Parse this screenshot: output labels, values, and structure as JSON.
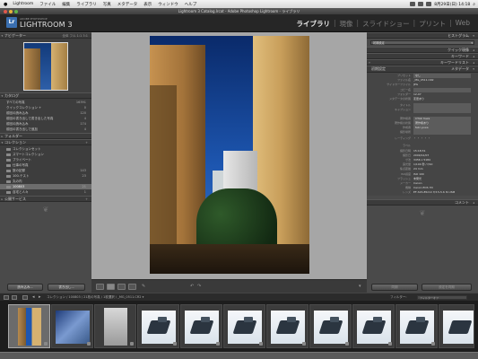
{
  "menubar": {
    "apple": "",
    "items": [
      "Lightroom",
      "ファイル",
      "編集",
      "ライブラリ",
      "写真",
      "メタデータ",
      "表示",
      "ウィンドウ",
      "ヘルプ"
    ],
    "clock": "8月29日(日) 14:18"
  },
  "window": {
    "title": "Lightroom 3 Catalog.lrcat - Adobe Photoshop Lightroom - ライブラリ"
  },
  "identity": {
    "logo": "Lr",
    "brand_small": "ADOBE PHOTOSHOP",
    "brand": "LIGHTROOM 3"
  },
  "modules": [
    {
      "label": "ライブラリ",
      "active": true
    },
    {
      "label": "現像",
      "active": false
    },
    {
      "label": "スライドショー",
      "active": false
    },
    {
      "label": "プリント",
      "active": false
    },
    {
      "label": "Web",
      "active": false
    }
  ],
  "left_panel": {
    "navigator": {
      "title": "ナビゲーター",
      "modes": "全体  フル  1:1  3:1"
    },
    "catalog": {
      "title": "カタログ",
      "items": [
        {
          "label": "すべての写真",
          "count": "16391"
        },
        {
          "label": "クイックコレクション +",
          "count": "0"
        },
        {
          "label": "前回の読み込み",
          "count": "120"
        },
        {
          "label": "前回の書き出しで書き出した写真",
          "count": "4"
        },
        {
          "label": "前回の読み込み",
          "count": "174"
        },
        {
          "label": "前回の書き出しで追加",
          "count": "4"
        }
      ]
    },
    "folders": {
      "title": "フォルダー"
    },
    "collections": {
      "title": "コレクション",
      "items": [
        {
          "label": "コレクションセット",
          "count": ""
        },
        {
          "label": "スマートコレクション",
          "count": ""
        },
        {
          "label": "プライベート",
          "count": ""
        },
        {
          "label": "仕事の写真",
          "count": ""
        },
        {
          "label": "旅の記録",
          "count": "143"
        },
        {
          "label": "100-テスト",
          "count": "23"
        },
        {
          "label": "丸の内",
          "count": ""
        },
        {
          "label": "100803",
          "count": "21",
          "selected": true
        },
        {
          "label": "自宅と人々",
          "count": "1"
        }
      ]
    },
    "publish": {
      "title": "公開サービス"
    },
    "import_button": "読み込み...",
    "export_button": "書き出し..."
  },
  "right_panel": {
    "histogram": {
      "title": "ヒストグラム"
    },
    "quick_develop": {
      "label": "クイック現像"
    },
    "preset_select": "初期設定",
    "keywords": {
      "title": "キーワード"
    },
    "keyword_list": {
      "title": "キーワードリスト"
    },
    "metadata": {
      "title": "メタデータ",
      "preset_label": "初期設定"
    },
    "fields": [
      {
        "k": "プリセット",
        "v": "なし"
      },
      {
        "k": "ファイル名",
        "v": "_MG_0511.CR2"
      },
      {
        "k": "サイドカーファイル",
        "v": "JPG"
      },
      {
        "k": "コピー名",
        "v": ""
      },
      {
        "k": "フォルダー",
        "v": "12-07"
      },
      {
        "k": "メタデータの状態",
        "v": "変更あり"
      },
      {
        "k": "タイトル",
        "v": ""
      },
      {
        "k": "キャプション",
        "v": ""
      },
      {
        "k": "著作権者",
        "v": "CTAb Yuwa"
      },
      {
        "k": "著作権の状態",
        "v": "著作権あり"
      },
      {
        "k": "作成者",
        "v": "fabi yuwa"
      },
      {
        "k": "撮影場所",
        "v": ""
      },
      {
        "k": "レーティング",
        "v": "・ ・ ・ ・ ・"
      },
      {
        "k": "ラベル",
        "v": ""
      },
      {
        "k": "撮影日時",
        "v": "15:18:31"
      },
      {
        "k": "撮影日",
        "v": "2009/12/07"
      },
      {
        "k": "寸法",
        "v": "3456 x 5184"
      },
      {
        "k": "露光量",
        "v": "1/100 秒 / f/10"
      },
      {
        "k": "焦点距離",
        "v": "24 mm"
      },
      {
        "k": "ISO感度",
        "v": "ISO 100"
      },
      {
        "k": "フラッシュ",
        "v": "未発光"
      },
      {
        "k": "メーカー",
        "v": "Canon"
      },
      {
        "k": "機種",
        "v": "Canon EOS 7D"
      },
      {
        "k": "レンズ",
        "v": "EF-S15-85mm f/3.5-5.6 IS USM"
      }
    ],
    "comments": {
      "title": "コメント"
    },
    "sync_meta": "同期",
    "sync_settings": "設定を同期"
  },
  "filmstrip": {
    "path": "コレクション / 100803 / 21枚の写真 / 1枚選択 / _MG_0511.CR2 ▾",
    "filter_label": "フィルター:",
    "filter_value": "フィルターオフ"
  }
}
